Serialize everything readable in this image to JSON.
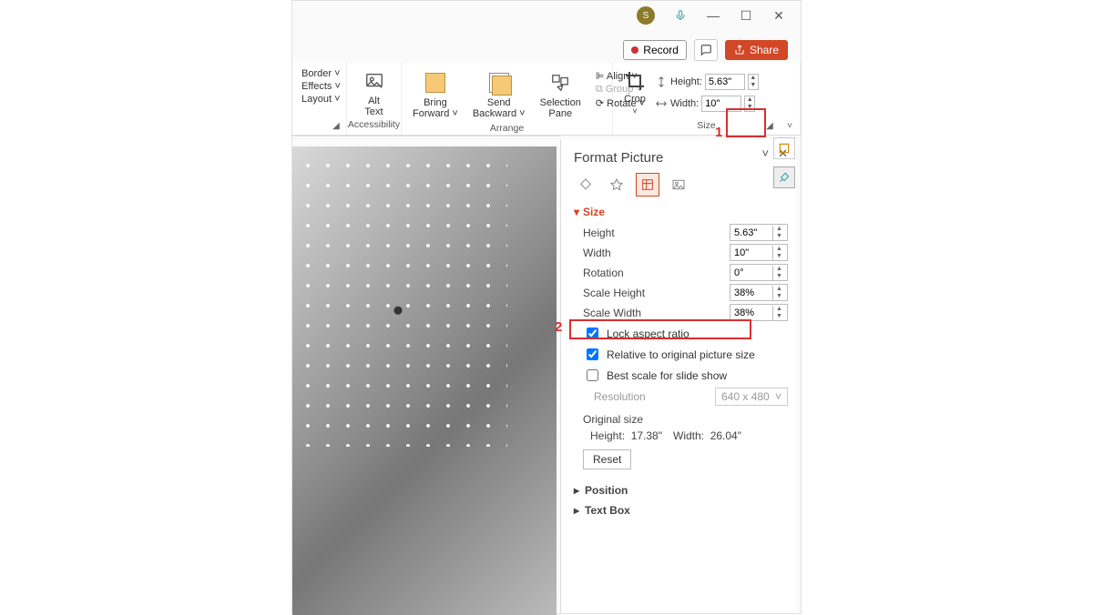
{
  "titlebar": {
    "avatar_initial": "S"
  },
  "toprow": {
    "record": "Record",
    "share": "Share"
  },
  "ribbon": {
    "left": {
      "border": "Border ˅",
      "effects": "Effects ˅",
      "layout": "Layout ˅"
    },
    "acc": {
      "btn": "Alt\nText",
      "label": "Accessibility"
    },
    "arrange": {
      "bring": "Bring\nForward ˅",
      "send": "Send\nBackward ˅",
      "selpane": "Selection\nPane",
      "align": "Align ˅",
      "group": "Group ˅",
      "rotate": "Rotate ˅",
      "label": "Arrange"
    },
    "size": {
      "crop": "Crop",
      "height_lbl": "Height:",
      "height_val": "5.63\"",
      "width_lbl": "Width:",
      "width_val": "10\"",
      "label": "Size"
    }
  },
  "annotations": {
    "a1": "1",
    "a2": "2"
  },
  "pane": {
    "title": "Format Picture",
    "size_header": "Size",
    "height_lbl": "Height",
    "height_val": "5.63\"",
    "width_lbl": "Width",
    "width_val": "10\"",
    "rotation_lbl": "Rotation",
    "rotation_val": "0°",
    "sh_lbl": "Scale Height",
    "sh_val": "38%",
    "sw_lbl": "Scale Width",
    "sw_val": "38%",
    "lock": "Lock aspect ratio",
    "rel": "Relative to original picture size",
    "best": "Best scale for slide show",
    "res_lbl": "Resolution",
    "res_val": "640 x 480",
    "orig_lbl": "Original size",
    "orig_h_lbl": "Height:",
    "orig_h_val": "17.38\"",
    "orig_w_lbl": "Width:",
    "orig_w_val": "26.04\"",
    "reset": "Reset",
    "position": "Position",
    "textbox": "Text Box"
  }
}
